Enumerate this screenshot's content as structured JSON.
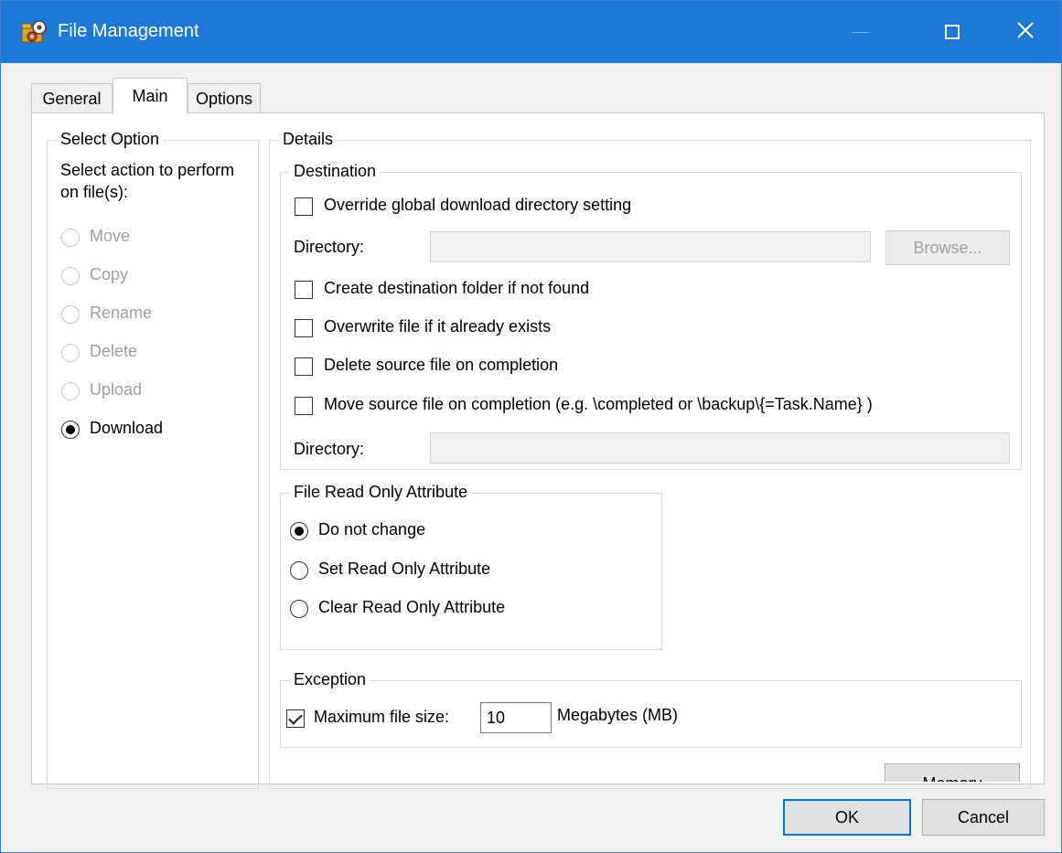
{
  "window": {
    "title": "File Management",
    "icon": "app-gear-folder-icon"
  },
  "tabs": [
    {
      "label": "General"
    },
    {
      "label": "Main"
    },
    {
      "label": "Options"
    }
  ],
  "select_option": {
    "title": "Select Option",
    "prompt": "Select action to perform on file(s):",
    "options": [
      {
        "label": "Move",
        "checked": false,
        "disabled": true
      },
      {
        "label": "Copy",
        "checked": false,
        "disabled": true
      },
      {
        "label": "Rename",
        "checked": false,
        "disabled": true
      },
      {
        "label": "Delete",
        "checked": false,
        "disabled": true
      },
      {
        "label": "Upload",
        "checked": false,
        "disabled": true
      },
      {
        "label": "Download",
        "checked": true,
        "disabled": false
      }
    ]
  },
  "details": {
    "title": "Details",
    "destination": {
      "title": "Destination",
      "override_label": "Override global download directory setting",
      "directory_label": "Directory:",
      "directory_value": "",
      "browse_label": "Browse...",
      "create_folder_label": "Create destination folder if not found",
      "overwrite_label": "Overwrite file if it already exists",
      "delete_source_label": "Delete source file on completion",
      "move_source_label": "Move source file on completion (e.g. \\completed or \\backup\\{=Task.Name} )",
      "directory2_label": "Directory:",
      "directory2_value": ""
    },
    "read_only": {
      "title": "File Read Only Attribute",
      "options": [
        {
          "label": "Do not change",
          "checked": true
        },
        {
          "label": "Set Read Only Attribute",
          "checked": false
        },
        {
          "label": "Clear Read Only Attribute",
          "checked": false
        }
      ]
    },
    "exception": {
      "title": "Exception",
      "max_size_label": "Maximum file size:",
      "max_size_value": "10",
      "unit_label": "Megabytes (MB)",
      "checked": true
    },
    "memory_label": "Memory"
  },
  "footer": {
    "ok_label": "OK",
    "cancel_label": "Cancel"
  },
  "colors": {
    "titlebar": "#1e78d7",
    "accent": "#0078d7"
  }
}
